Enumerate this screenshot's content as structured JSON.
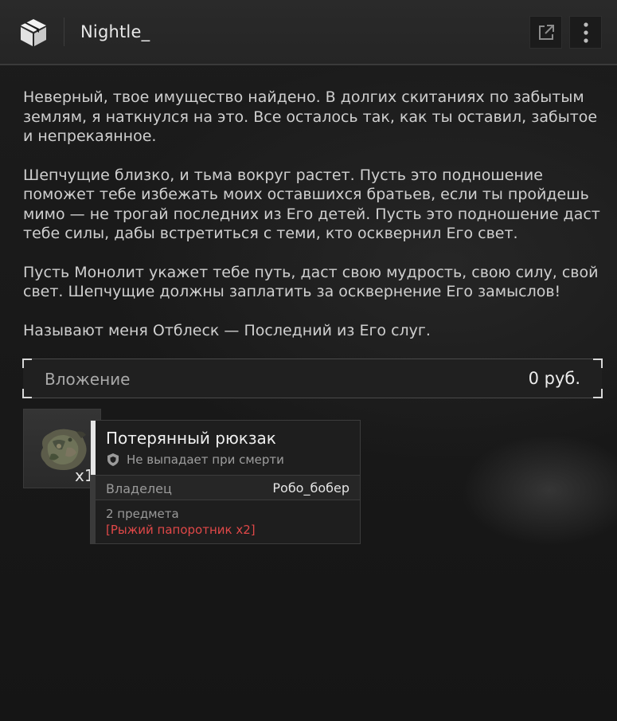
{
  "header": {
    "title": "Nightle_",
    "icons": {
      "app": "package-box-icon",
      "open": "external-link-icon",
      "more": "more-vertical-icon"
    }
  },
  "message": {
    "paragraphs": [
      "Неверный, твое имущество найдено. В долгих скитаниях по забытым землям, я наткнулся на это. Все осталось так, как ты оставил, забытое и непрекаянное.",
      "Шепчущие близко, и тьма вокруг растет. Пусть это подношение поможет тебе избежать моих оставшихся братьев, если ты пройдешь мимо — не трогай последних из Его детей. Пусть это подношение даст тебе силы, дабы встретиться с теми, кто осквернил Его свет.",
      "Пусть Монолит укажет тебе путь, даст свою мудрость, свою силу, свой свет. Шепчущие должны заплатить за осквернение Его замыслов!",
      "Называют меня Отблеск — Последний из Его слуг."
    ]
  },
  "attachment": {
    "label": "Вложение",
    "value": "0 руб."
  },
  "item": {
    "count": "x1",
    "icon": "backpack-icon",
    "tooltip": {
      "name": "Потерянный рюкзак",
      "safe_text": "Не выпадает при смерти",
      "safe_icon": "shield-icon",
      "owner_label": "Владелец",
      "owner_value": "Робо_бобер",
      "contents_count": "2 предмета",
      "contents_item": "[Рыжий папоротник x2]"
    }
  },
  "colors": {
    "background": "#181818",
    "header": "#282828",
    "accent_red": "#e04848",
    "text": "#cfcfcf"
  }
}
